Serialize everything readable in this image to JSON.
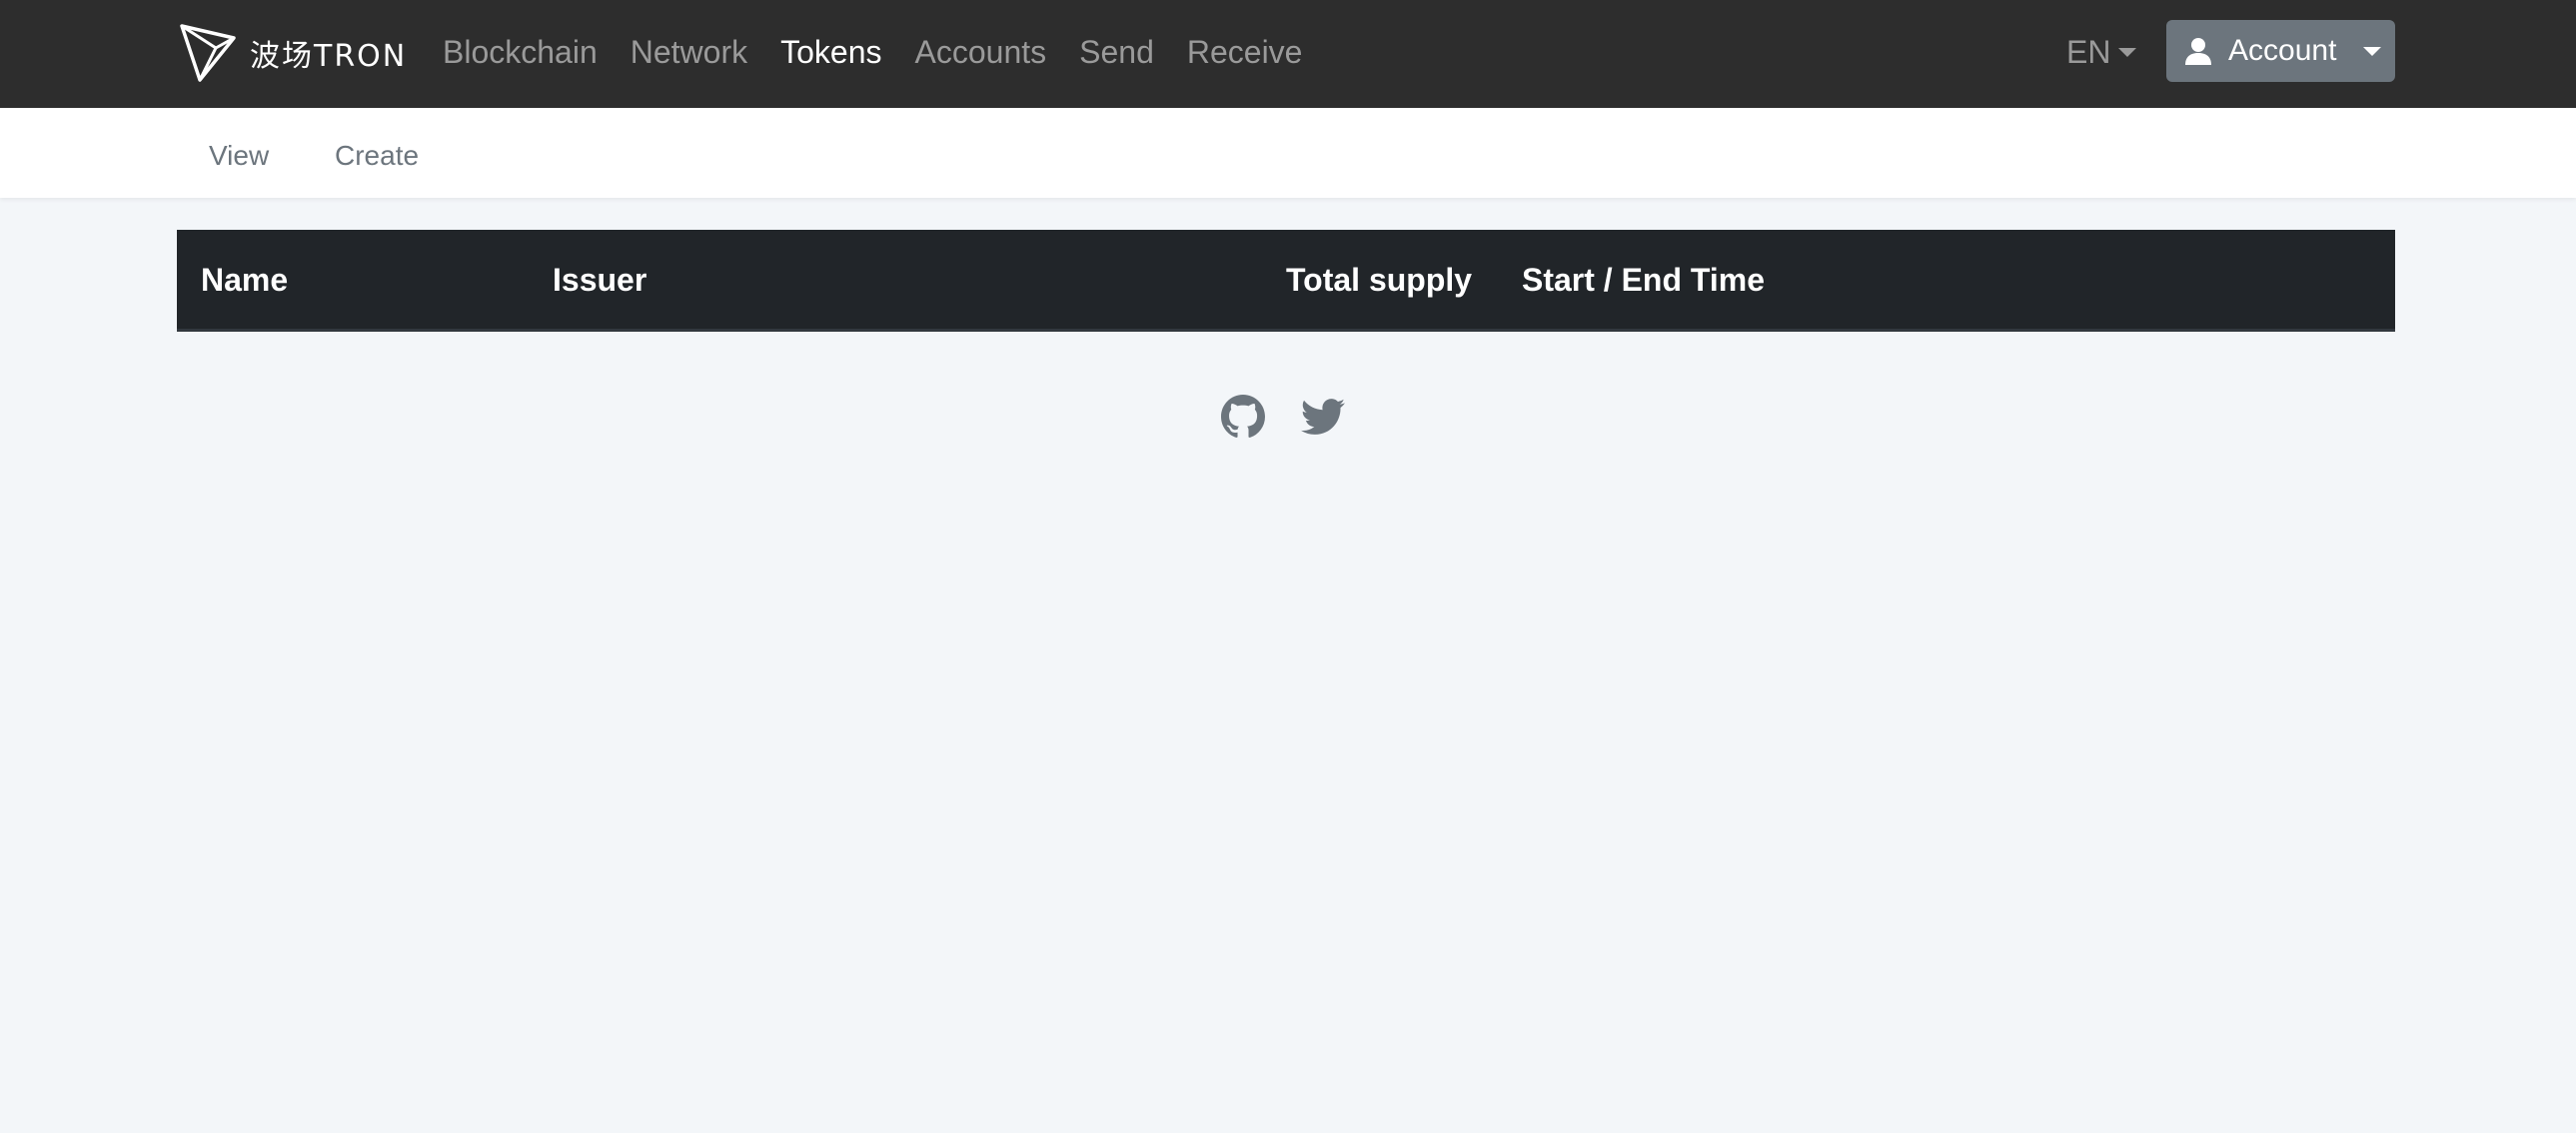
{
  "header": {
    "logo_text": "波场TRON",
    "nav": [
      "Blockchain",
      "Network",
      "Tokens",
      "Accounts",
      "Send",
      "Receive"
    ],
    "active_nav": "Tokens",
    "language": "EN",
    "account_label": "Account",
    "icons": {
      "logo": "tron-logo-icon",
      "user": "user-icon",
      "caret": "caret-down-icon"
    }
  },
  "subnav": {
    "view_label": "View",
    "create_label": "Create"
  },
  "table": {
    "headers": [
      "Name",
      "Issuer",
      "Total supply",
      "Start / End Time"
    ],
    "rows": []
  },
  "footer": {
    "icons": [
      "github-icon",
      "twitter-icon"
    ]
  },
  "colors": {
    "topbar_bg": "#2d2d2d",
    "page_bg": "#f3f6f9",
    "table_header_bg": "#212529",
    "account_btn_bg": "#6c757d",
    "footer_icon": "#6c757d"
  }
}
